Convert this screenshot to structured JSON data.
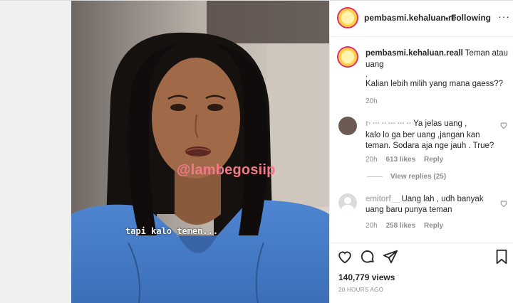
{
  "post": {
    "username": "pembasmi.kehaluan.re",
    "dot": "•",
    "follow_status": "Following",
    "more": "···",
    "watermark": "@lambegosiip",
    "subtitle": "tapi kalo temen..."
  },
  "caption": {
    "username": "pembasmi.kehaluan.reall",
    "line1": "Teman atau",
    "line2": "uang",
    "line3": ".",
    "line4": "Kalian lebih milih yang mana gaess??",
    "time": "20h"
  },
  "comments": [
    {
      "user_visible": "r· ··· ·· ··· ··· ··",
      "text_line1": "Ya jelas uang ,",
      "text_line2": "kalo lo ga ber uang ,jangan kan",
      "text_line3": "teman. Sodara aja nge jauh . True?",
      "time": "20h",
      "likes": "613 likes",
      "reply": "Reply",
      "view_replies": "View replies (25)",
      "like_icon": "heart-outline-icon"
    },
    {
      "user_visible": "emitorf__",
      "text_line1": "Uang lah , udh banyak",
      "text_line2": "uang baru punya teman",
      "time": "20h",
      "likes": "258 likes",
      "reply": "Reply",
      "like_icon": "heart-outline-icon"
    }
  ],
  "actions": {
    "like_icon": "heart-outline-icon",
    "comment_icon": "comment-bubble-icon",
    "share_icon": "paper-plane-icon",
    "save_icon": "bookmark-icon"
  },
  "stats": {
    "views": "140,779 views",
    "posted": "20 HOURS AGO"
  },
  "colors": {
    "watermark": "#f07a86",
    "avatar_ring": "#e1306c",
    "shirt": "#5a8fd6"
  }
}
